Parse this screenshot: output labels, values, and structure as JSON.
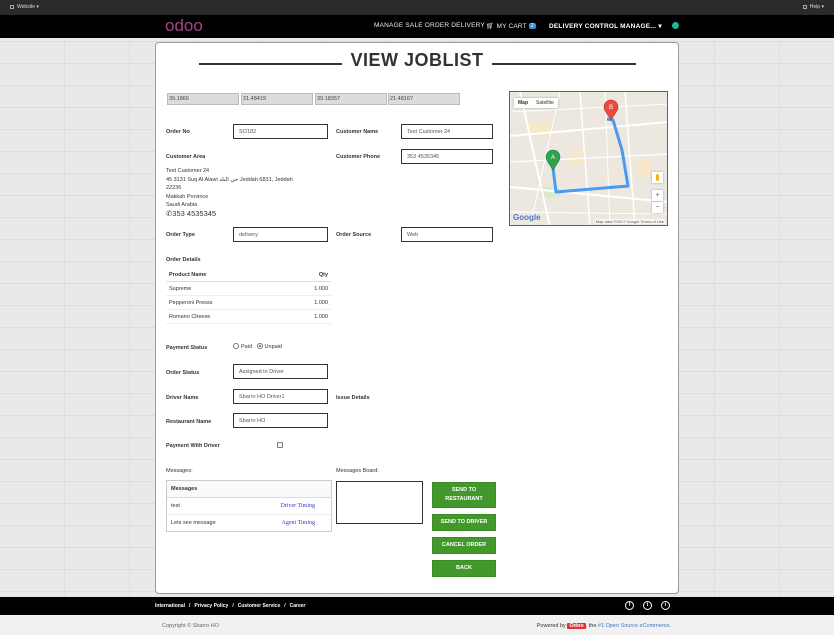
{
  "admin_bar": {
    "website_label": "Website",
    "help_label": "Help"
  },
  "nav": {
    "logo_text": "odoo",
    "manage_label": "MANAGE SALE ORDER DELIVERY",
    "cart_label": "MY CART",
    "cart_count": "2",
    "delivery_menu_label": "DELIVERY CONTROL MANAGE...",
    "status_color": "#21b799"
  },
  "page": {
    "title": "VIEW JOBLIST"
  },
  "coordinates": [
    "39.1866",
    "21.48419",
    "39.18357",
    "21.48167"
  ],
  "form": {
    "order_no_label": "Order No",
    "order_no": "SO182",
    "customer_name_label": "Customer Name",
    "customer_name": "Test Customer 24",
    "customer_area_label": "Customer Area",
    "customer_phone_label": "Customer Phone",
    "customer_phone": "353 4535345",
    "address": {
      "line1": "Test Customer 24",
      "line2": "45 3131 Suq Al Alawi حي البلد Jeddah 6831, Jeddah",
      "line3": "22236",
      "line4": "Makkah Province",
      "line5": "Saudi Arabia",
      "phone": "353 4535345"
    },
    "order_type_label": "Order Type",
    "order_type": "delivery",
    "order_source_label": "Order Source",
    "order_source": "Web",
    "order_details_label": "Order Details",
    "payment_status_label": "Payment Status",
    "paid_label": "Paid",
    "unpaid_label": "Unpaid",
    "order_status_label": "Order Status",
    "order_status": "Assigned to Driver",
    "driver_name_label": "Driver Name",
    "driver_name": "Sbarro HO Driver1",
    "issue_details_label": "Issue Details",
    "restaurant_name_label": "Restaurant Name",
    "restaurant_name": "Sbarro HO",
    "payment_with_driver_label": "Payment With Driver",
    "messages_label": "Messages:",
    "messages_board_label": "Messages Board:"
  },
  "order_details": {
    "headers": [
      "Product Name",
      "Qty"
    ],
    "rows": [
      {
        "product": "Supreme",
        "qty": "1.000"
      },
      {
        "product": "Pepperoni Presss",
        "qty": "1.000"
      },
      {
        "product": "Romano Cheese",
        "qty": "1.000"
      }
    ]
  },
  "messages": {
    "header": "Messages",
    "rows": [
      {
        "text": "test",
        "source": "Driver Timing"
      },
      {
        "text": "Lets see message",
        "source": "Agent Timing"
      }
    ]
  },
  "buttons": {
    "send_to_restaurant": "SEND TO RESTAURANT",
    "send_to_driver": "SEND TO DRIVER",
    "cancel_order": "CANCEL ORDER",
    "back": "BACK"
  },
  "map": {
    "tab_map": "Map",
    "tab_satellite": "Satellite",
    "marker_a": "A",
    "marker_b": "B",
    "zoom_in": "+",
    "zoom_out": "−",
    "google_label": "Google",
    "attribution": "Map data ©2017 Google  Terms of Use",
    "route_color": "#4a9af0"
  },
  "footer": {
    "links": [
      "International",
      "Privacy Policy",
      "Customer Service",
      "Career"
    ],
    "social": [
      "f",
      "t",
      "i"
    ]
  },
  "copyright": {
    "text": "Copyright © Sbarro HO",
    "powered_by": "Powered by",
    "brand": "Odoo",
    "the": ", the",
    "link_text": "#1 Open Source eCommerce",
    "end": "."
  }
}
